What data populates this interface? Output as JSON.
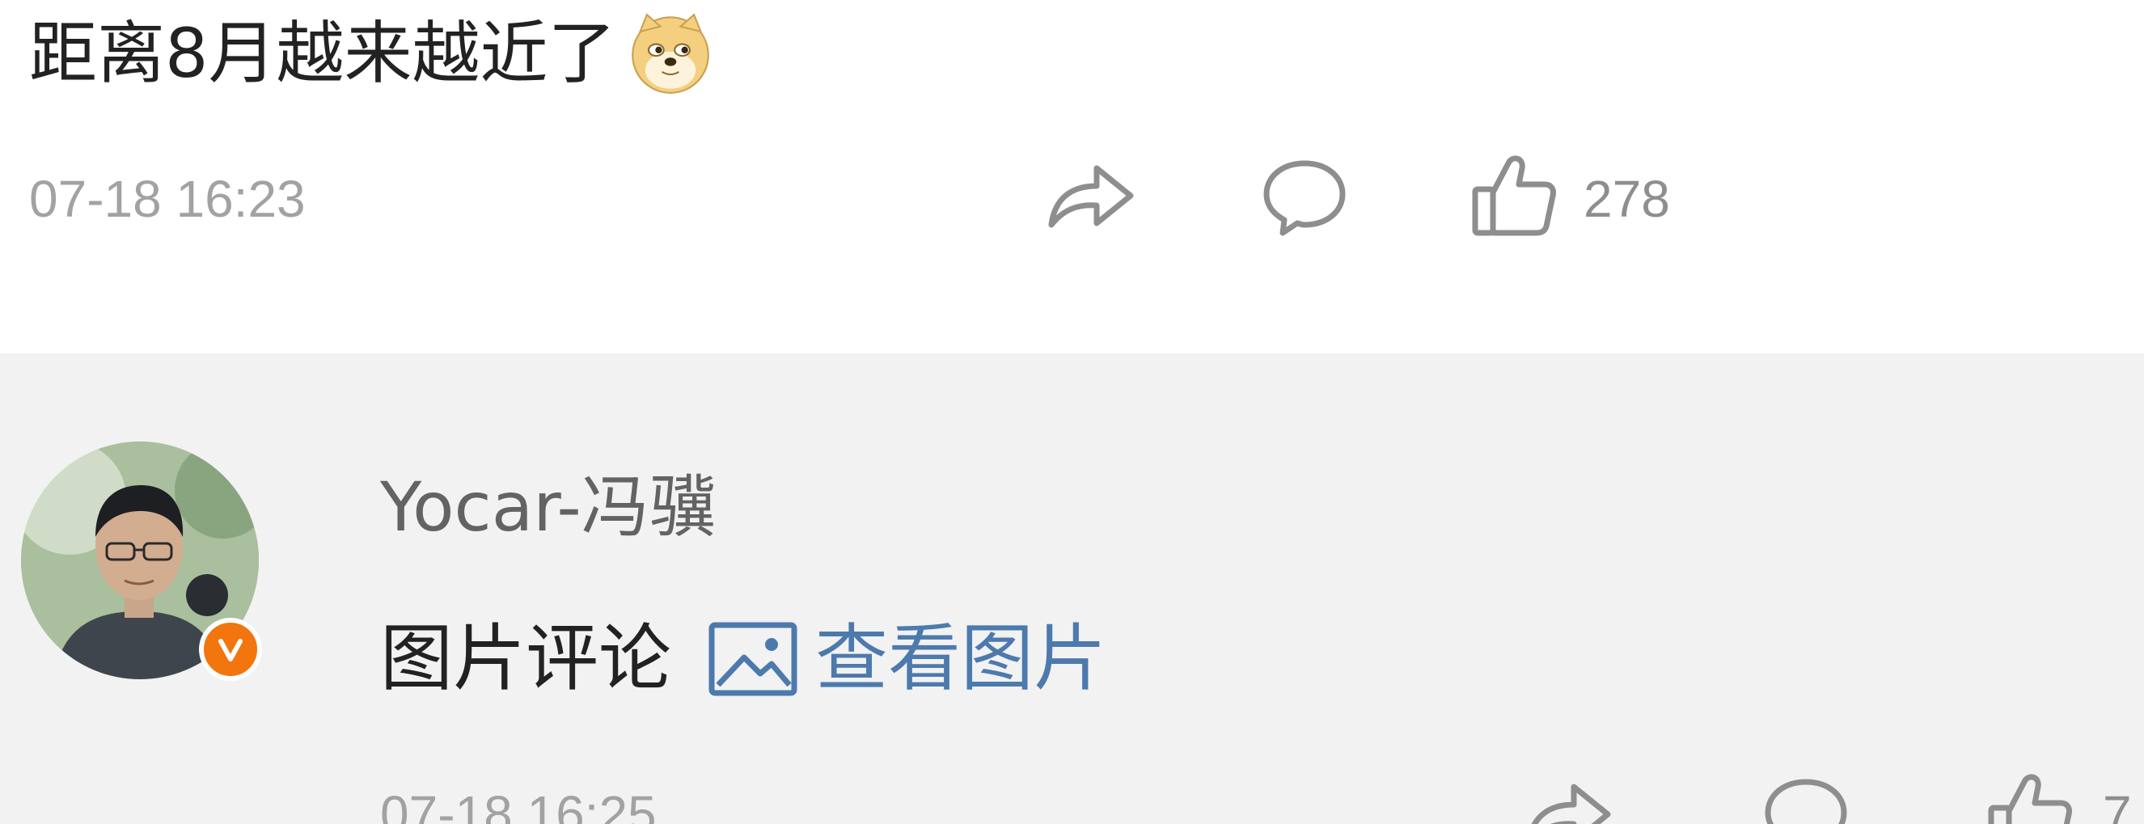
{
  "post": {
    "text": "距离8月越来越近了",
    "emoji": "doge-emoji",
    "time": "07-18 16:23",
    "like_count": "278"
  },
  "comment": {
    "username": "Yocar-冯骥",
    "verified_badge": "V",
    "text": "图片评论",
    "view_link": "查看图片",
    "time": "07-18 16:25",
    "like_count": "7"
  },
  "colors": {
    "link": "#4d7aad",
    "badge": "#f2750e",
    "timestamp": "#a2a2a2",
    "comment_bg": "#f2f2f2"
  },
  "icons": [
    "share-icon",
    "comment-icon",
    "like-icon",
    "picture-icon",
    "doge-emoji"
  ]
}
